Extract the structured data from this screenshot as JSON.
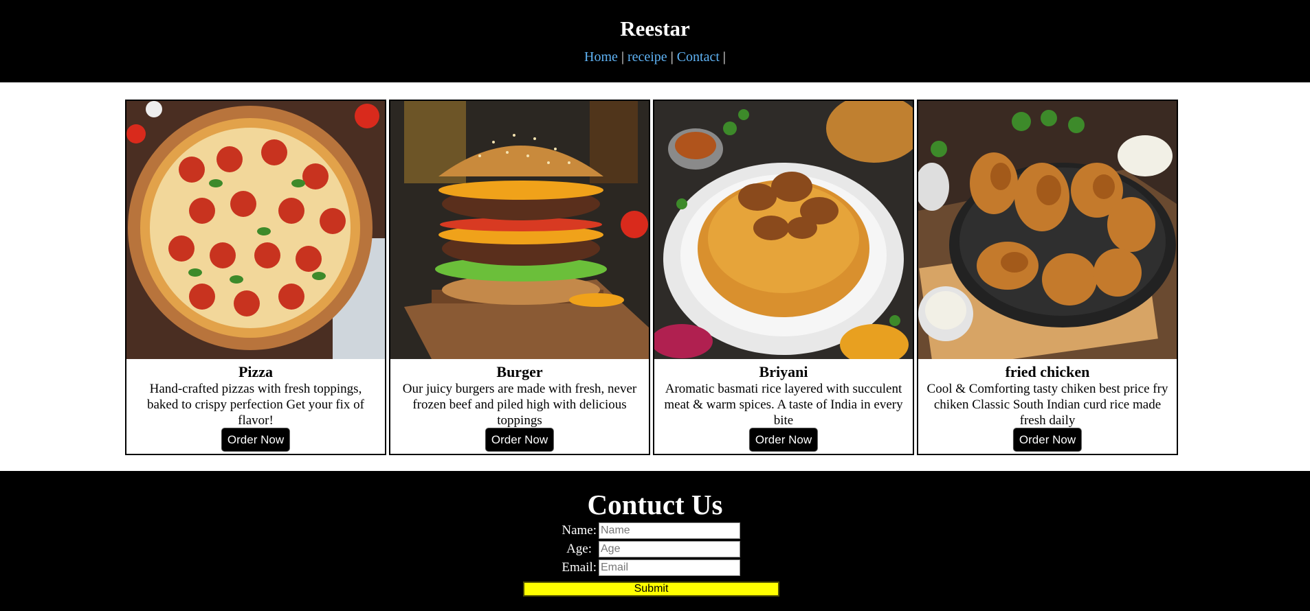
{
  "header": {
    "title": "Reestar",
    "nav": [
      {
        "label": "Home"
      },
      {
        "label": "receipe"
      },
      {
        "label": "Contact"
      }
    ],
    "separator": "|",
    "colors": {
      "background": "#000000",
      "link": "#5fb3f5"
    }
  },
  "cards": [
    {
      "image_icon": "pizza-image",
      "title": "Pizza",
      "desc_lines": [
        "Hand-crafted pizzas with fresh toppings,",
        "baked to crispy perfection Get your fix of",
        "flavor!"
      ],
      "button": "Order Now"
    },
    {
      "image_icon": "burger-image",
      "title": "Burger",
      "desc_lines": [
        "Our juicy burgers are made with fresh, never",
        "frozen beef and piled high with delicious",
        "toppings"
      ],
      "button": "Order Now"
    },
    {
      "image_icon": "biryani-image",
      "title": "Briyani",
      "desc_lines": [
        "Aromatic basmati rice layered with succulent",
        "meat & warm spices. A taste of India in every",
        "bite"
      ],
      "button": "Order Now"
    },
    {
      "image_icon": "fried-chicken-image",
      "title": "fried chicken",
      "desc_lines": [
        "Cool & Comforting tasty chiken best price fry",
        "chiken Classic South Indian curd rice made",
        "fresh daily"
      ],
      "button": "Order Now"
    }
  ],
  "contact": {
    "title": "Contuct Us",
    "fields": [
      {
        "label": "Name:",
        "placeholder": "Name",
        "value": ""
      },
      {
        "label": "Age:",
        "placeholder": "Age",
        "value": ""
      },
      {
        "label": "Email:",
        "placeholder": "Email",
        "value": ""
      }
    ],
    "submit": "Submit",
    "colors": {
      "submit_bg": "#ffff00"
    }
  }
}
